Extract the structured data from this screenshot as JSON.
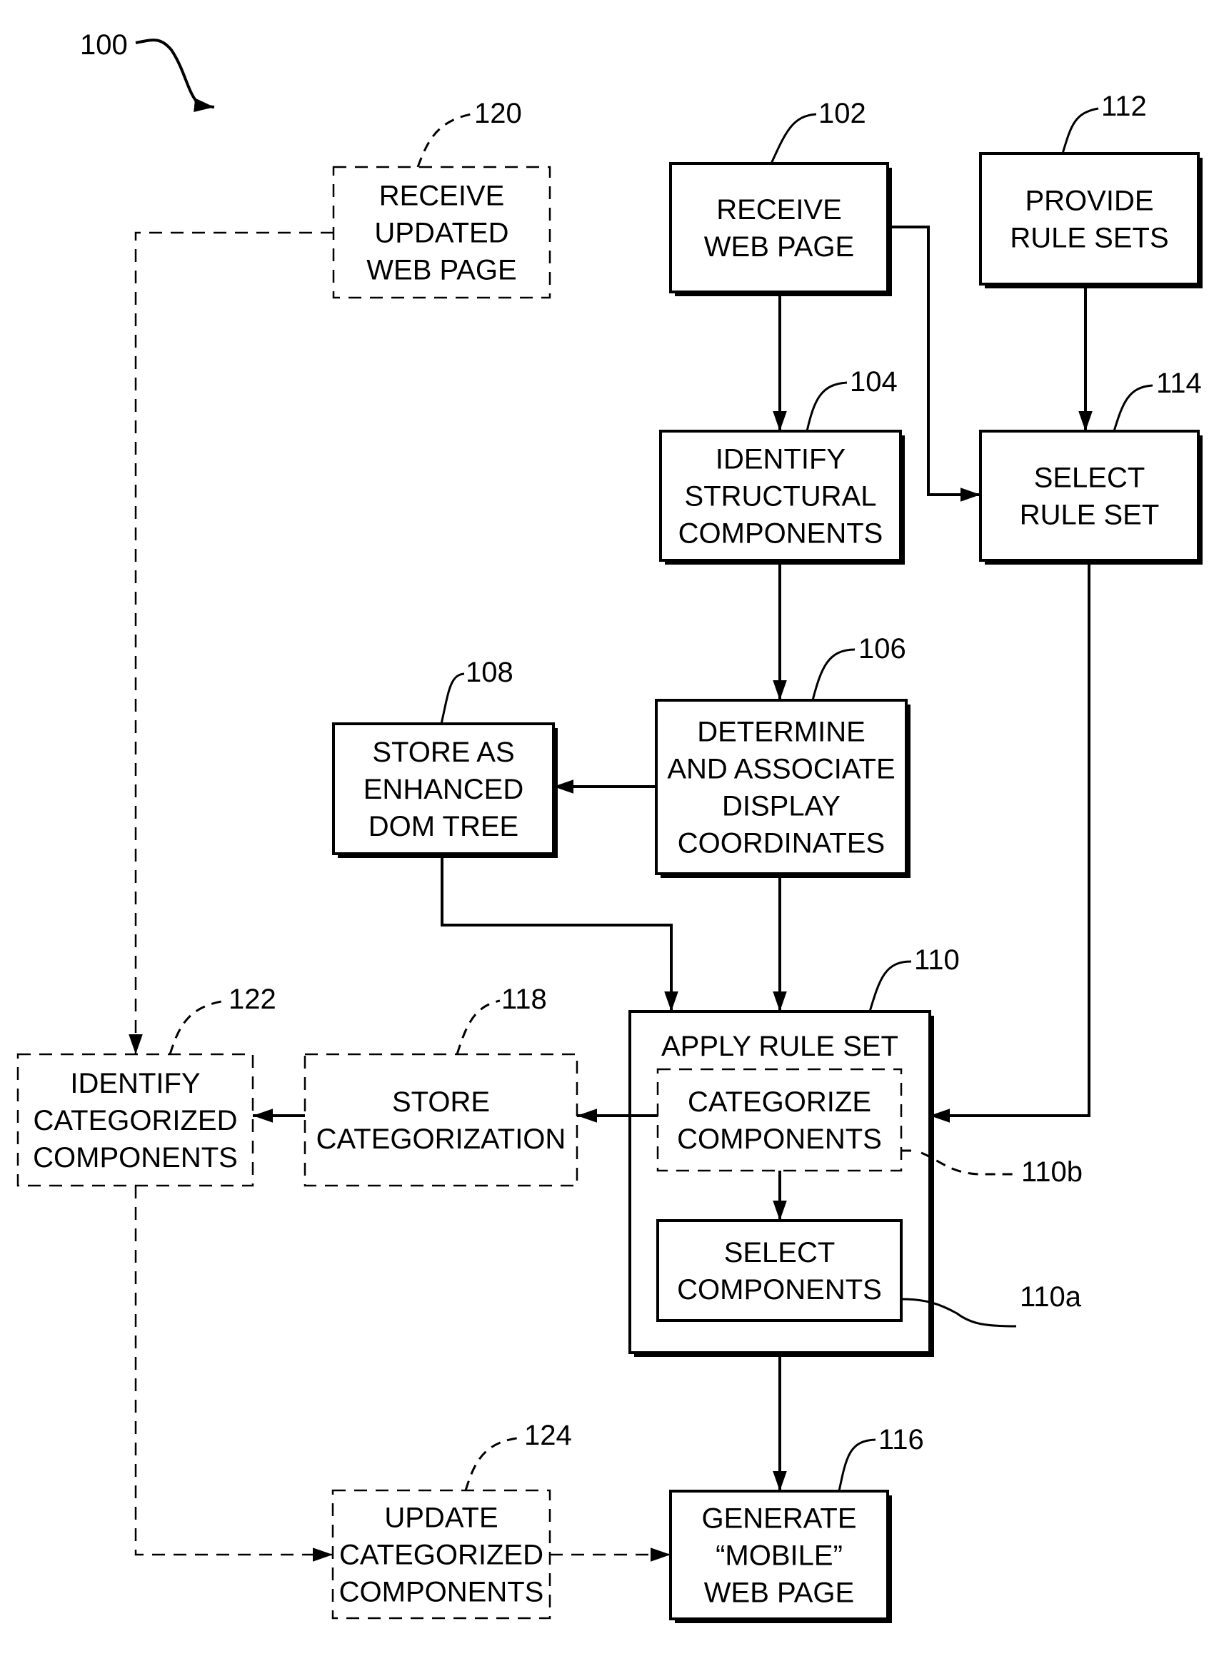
{
  "figure": {
    "number": "100",
    "steps": [
      {
        "id": "102",
        "lines": [
          "RECEIVE",
          "WEB PAGE"
        ],
        "style": "solid"
      },
      {
        "id": "104",
        "lines": [
          "IDENTIFY",
          "STRUCTURAL",
          "COMPONENTS"
        ],
        "style": "solid"
      },
      {
        "id": "106",
        "lines": [
          "DETERMINE",
          "AND ASSOCIATE",
          "DISPLAY",
          "COORDINATES"
        ],
        "style": "solid"
      },
      {
        "id": "108",
        "lines": [
          "STORE AS",
          "ENHANCED",
          "DOM TREE"
        ],
        "style": "solid"
      },
      {
        "id": "110",
        "lines": [
          "APPLY RULE SET"
        ],
        "style": "solid"
      },
      {
        "id": "110b",
        "lines": [
          "CATEGORIZE",
          "COMPONENTS"
        ],
        "style": "dashed"
      },
      {
        "id": "110a",
        "lines": [
          "SELECT",
          "COMPONENTS"
        ],
        "style": "solid"
      },
      {
        "id": "112",
        "lines": [
          "PROVIDE",
          "RULE SETS"
        ],
        "style": "solid"
      },
      {
        "id": "114",
        "lines": [
          "SELECT",
          "RULE SET"
        ],
        "style": "solid"
      },
      {
        "id": "116",
        "lines": [
          "GENERATE",
          "“MOBILE”",
          "WEB PAGE"
        ],
        "style": "solid"
      },
      {
        "id": "118",
        "lines": [
          "STORE",
          "CATEGORIZATION"
        ],
        "style": "dashed"
      },
      {
        "id": "120",
        "lines": [
          "RECEIVE",
          "UPDATED",
          "WEB PAGE"
        ],
        "style": "dashed"
      },
      {
        "id": "122",
        "lines": [
          "IDENTIFY",
          "CATEGORIZED",
          "COMPONENTS"
        ],
        "style": "dashed"
      },
      {
        "id": "124",
        "lines": [
          "UPDATE",
          "CATEGORIZED",
          "COMPONENTS"
        ],
        "style": "dashed"
      }
    ],
    "edges": [
      {
        "from": "102",
        "to": "104",
        "style": "solid"
      },
      {
        "from": "102",
        "to": "114",
        "style": "solid"
      },
      {
        "from": "112",
        "to": "114",
        "style": "solid"
      },
      {
        "from": "104",
        "to": "106",
        "style": "solid"
      },
      {
        "from": "106",
        "to": "108",
        "style": "solid"
      },
      {
        "from": "108",
        "to": "110",
        "style": "solid"
      },
      {
        "from": "106",
        "to": "110",
        "style": "solid"
      },
      {
        "from": "114",
        "to": "110",
        "style": "solid"
      },
      {
        "from": "110b",
        "to": "110a",
        "style": "solid"
      },
      {
        "from": "110b",
        "to": "118",
        "style": "solid"
      },
      {
        "from": "118",
        "to": "122",
        "style": "solid"
      },
      {
        "from": "120",
        "to": "122",
        "style": "dashed"
      },
      {
        "from": "122",
        "to": "124",
        "style": "dashed"
      },
      {
        "from": "124",
        "to": "116",
        "style": "dashed"
      },
      {
        "from": "110",
        "to": "116",
        "style": "solid"
      }
    ]
  }
}
